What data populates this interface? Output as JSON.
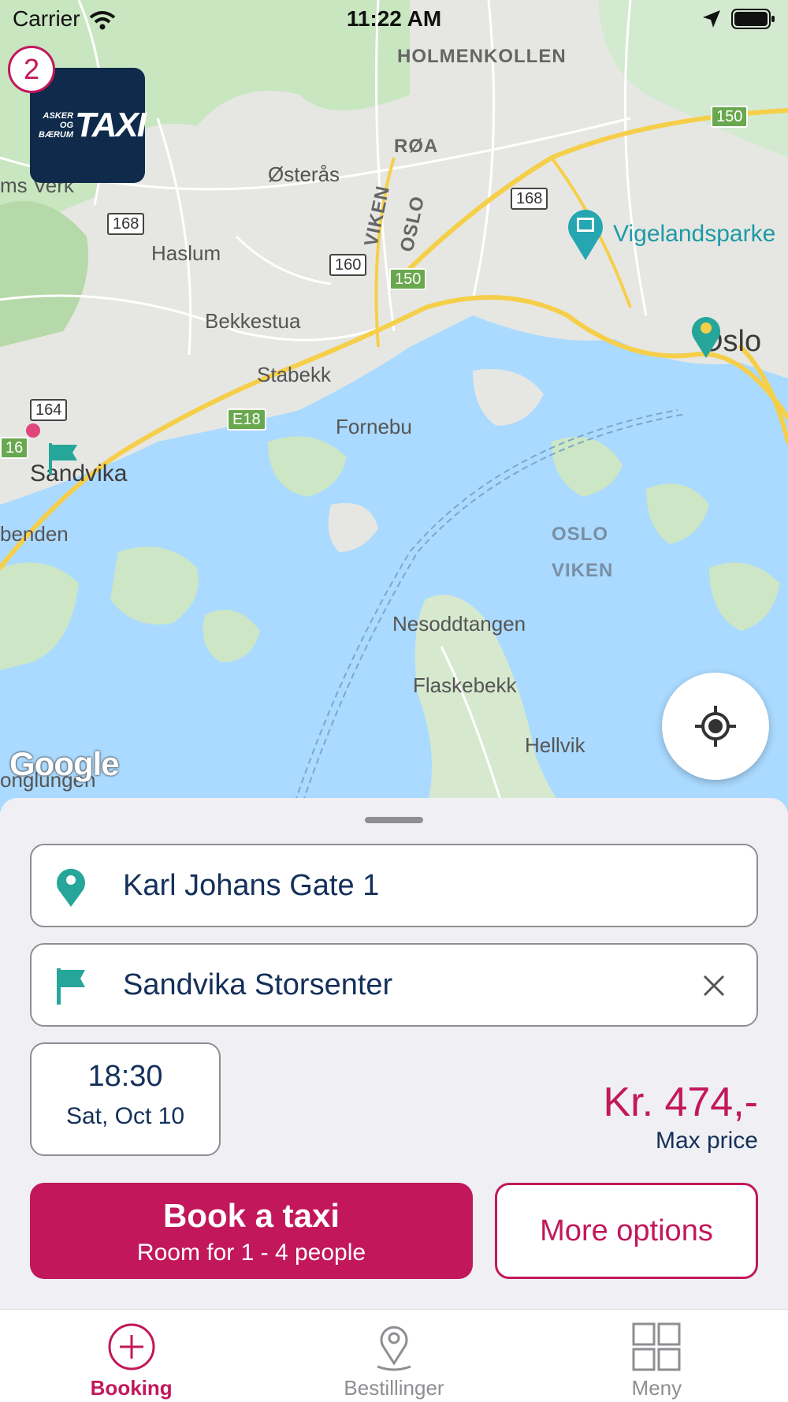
{
  "status_bar": {
    "carrier": "Carrier",
    "time": "11:22 AM"
  },
  "map": {
    "labels": {
      "holmenkollen": "HOLMENKOLLEN",
      "roa": "RØA",
      "osteras": "Østerås",
      "ms_verk": "ms Verk",
      "haslum": "Haslum",
      "viken_road": "VIKEN",
      "oslo_road": "OSLO",
      "bekkestua": "Bekkestua",
      "stabekk": "Stabekk",
      "fornebu": "Fornebu",
      "sandvika": "Sandvika",
      "benden": "benden",
      "vigelandsparken": "Vigelandsparke",
      "oslo_city": "Oslo",
      "oslo_water": "OSLO",
      "viken_water": "VIKEN",
      "nesoddtangen": "Nesoddtangen",
      "flaskebekk": "Flaskebekk",
      "hellvik": "Hellvik",
      "onglungen": "onglungen"
    },
    "shields": {
      "r150a": "150",
      "r168a": "168",
      "r168b": "168",
      "r160": "160",
      "r150b": "150",
      "r164": "164",
      "e18": "E18",
      "r16": "16"
    },
    "attribution": "Google"
  },
  "logo": {
    "line1": "ASKER OG",
    "line2": "BÆRUM",
    "word": "TAXI"
  },
  "badge_count": "2",
  "booking": {
    "pickup": "Karl Johans Gate 1",
    "destination": "Sandvika Storsenter",
    "time": "18:30",
    "date": "Sat, Oct 10",
    "price": "Kr. 474,-",
    "price_label": "Max price",
    "book_label": "Book a taxi",
    "book_sub": "Room for 1 - 4 people",
    "more_label": "More options"
  },
  "tabs": [
    {
      "label": "Booking",
      "icon": "plus-circle-icon"
    },
    {
      "label": "Bestillinger",
      "icon": "map-pin-icon"
    },
    {
      "label": "Meny",
      "icon": "grid-icon"
    }
  ],
  "colors": {
    "accent": "#c2185b",
    "navy": "#14305a",
    "teal": "#26a69a",
    "water": "#aadaff"
  }
}
